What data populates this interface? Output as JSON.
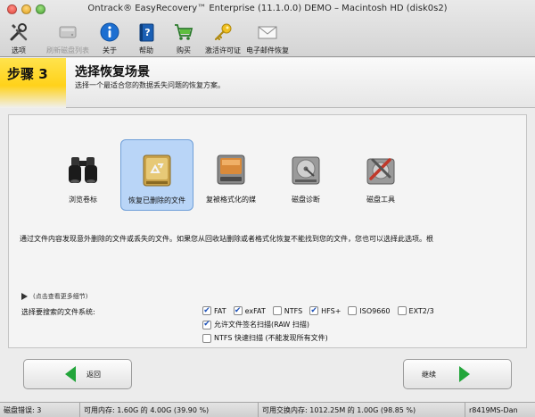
{
  "window": {
    "title": "Ontrack® EasyRecovery™ Enterprise (11.1.0.0) DEMO – Macintosh HD (disk0s2)"
  },
  "toolbar": {
    "items": [
      {
        "label": "选项",
        "icon": "tools-icon",
        "enabled": true
      },
      {
        "label": "刷新磁盘列表",
        "icon": "drive-refresh-icon",
        "enabled": false
      },
      {
        "label": "关于",
        "icon": "info-icon",
        "enabled": true
      },
      {
        "label": "帮助",
        "icon": "help-book-icon",
        "enabled": true
      },
      {
        "label": "购买",
        "icon": "shopping-cart-icon",
        "enabled": true
      },
      {
        "label": "激活许可证",
        "icon": "key-icon",
        "enabled": true
      },
      {
        "label": "电子邮件恢复",
        "icon": "envelope-icon",
        "enabled": true
      }
    ]
  },
  "step": {
    "badge": "步骤 3",
    "title": "选择恢复场景",
    "description": "选择一个最适合您的数据丢失问题的恢复方案。"
  },
  "scenarios": [
    {
      "label": "浏览卷标",
      "icon": "binoculars-icon",
      "selected": false
    },
    {
      "label": "恢复已删除的文件",
      "icon": "recycle-drive-icon",
      "selected": true
    },
    {
      "label": "复被格式化的媒",
      "icon": "formatted-drive-icon",
      "selected": false
    },
    {
      "label": "磁盘诊断",
      "icon": "disk-diagnostics-icon",
      "selected": false
    },
    {
      "label": "磁盘工具",
      "icon": "disk-tools-icon",
      "selected": false
    }
  ],
  "scenario_description": "通过文件内容发现意外删除的文件或丢失的文件。如果您从回收站删除或者格式化恢复不能找到您的文件，您也可以选择此选项。根",
  "more_details": "(点击查看更多细节)",
  "filesystem": {
    "label": "选择要搜索的文件系统:",
    "options": [
      {
        "label": "FAT",
        "checked": true
      },
      {
        "label": "exFAT",
        "checked": true
      },
      {
        "label": "NTFS",
        "checked": false
      },
      {
        "label": "HFS+",
        "checked": true
      },
      {
        "label": "ISO9660",
        "checked": false
      },
      {
        "label": "EXT2/3",
        "checked": false
      }
    ],
    "raw_scan": {
      "label": "允许文件签名扫描(RAW 扫描)",
      "checked": true
    },
    "ntfs_quick": {
      "label": "NTFS 快速扫描 (不能发现所有文件)",
      "checked": false
    }
  },
  "buttons": {
    "back": "返回",
    "next": "继续"
  },
  "statusbar": {
    "disk_errors": "磁盘错误: 3",
    "memory": "可用内存: 1.60G 的 4.00G (39.90 %)",
    "swap": "可用交换内存: 1012.25M 的 1.00G (98.85 %)",
    "build": "r8419MS-Dan"
  },
  "colors": {
    "step_badge": "#ffd21a",
    "selection": "#b9d5f7",
    "arrow": "#22a53a",
    "checkmark": "#1a4fb8"
  }
}
